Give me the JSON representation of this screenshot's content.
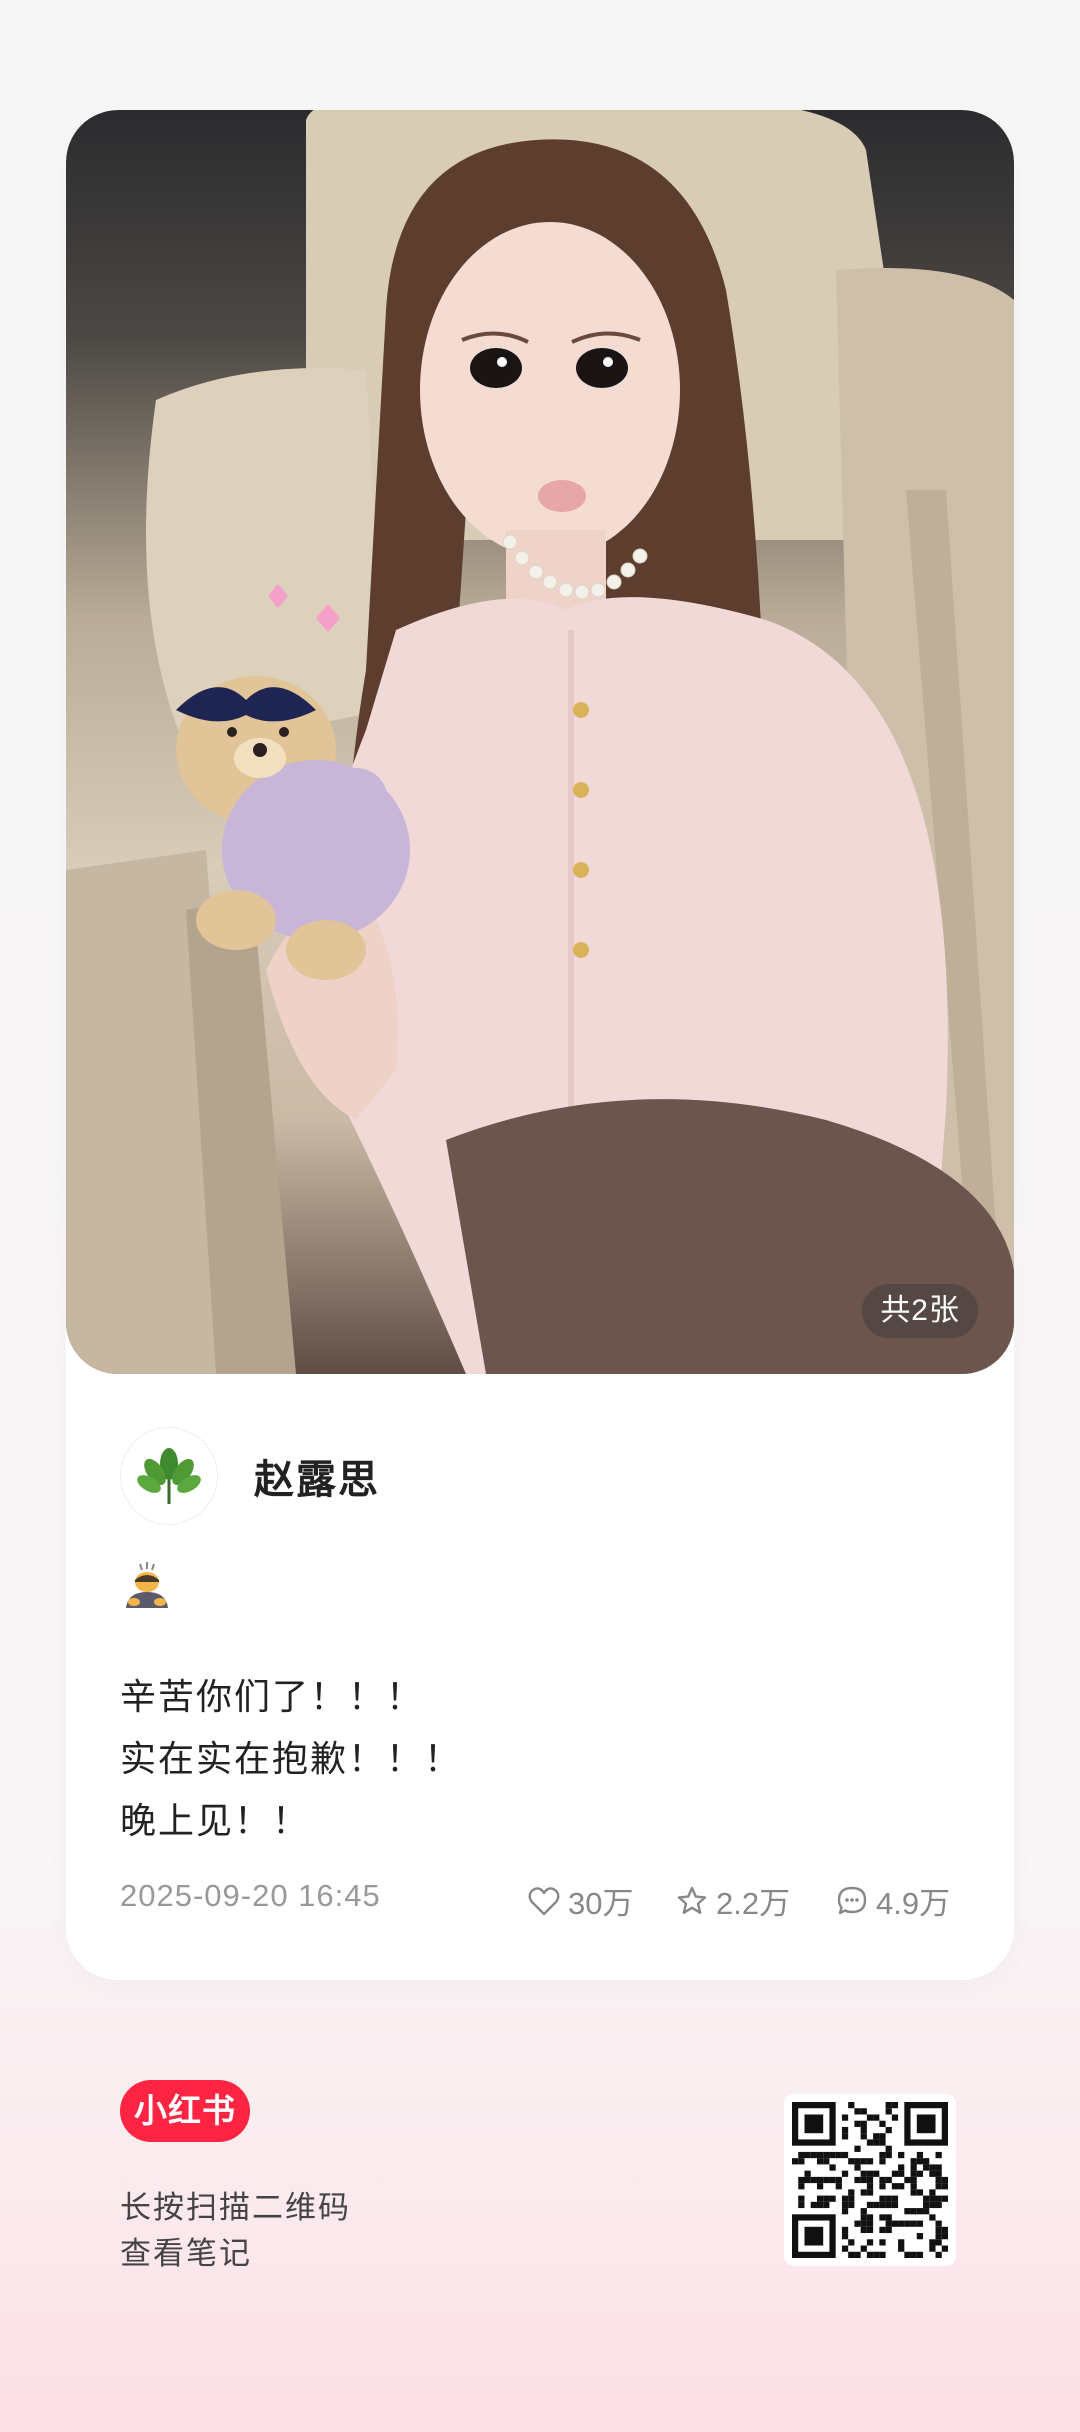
{
  "post": {
    "image_count_label": "共2张",
    "author_name": "赵露思",
    "emoji_icon": "person-bowing-emoji",
    "lines": [
      "辛苦你们了！！！",
      "实在实在抱歉！！！",
      "晚上见！！"
    ],
    "date": "2025-09-20 16:45",
    "likes": "30万",
    "collects": "2.2万",
    "comments": "4.9万"
  },
  "footer": {
    "logo_text": "小红书",
    "scan_line1": "长按扫描二维码",
    "scan_line2": "查看笔记"
  },
  "colors": {
    "brand": "#ff2442",
    "text": "#222222",
    "muted": "#999999"
  }
}
